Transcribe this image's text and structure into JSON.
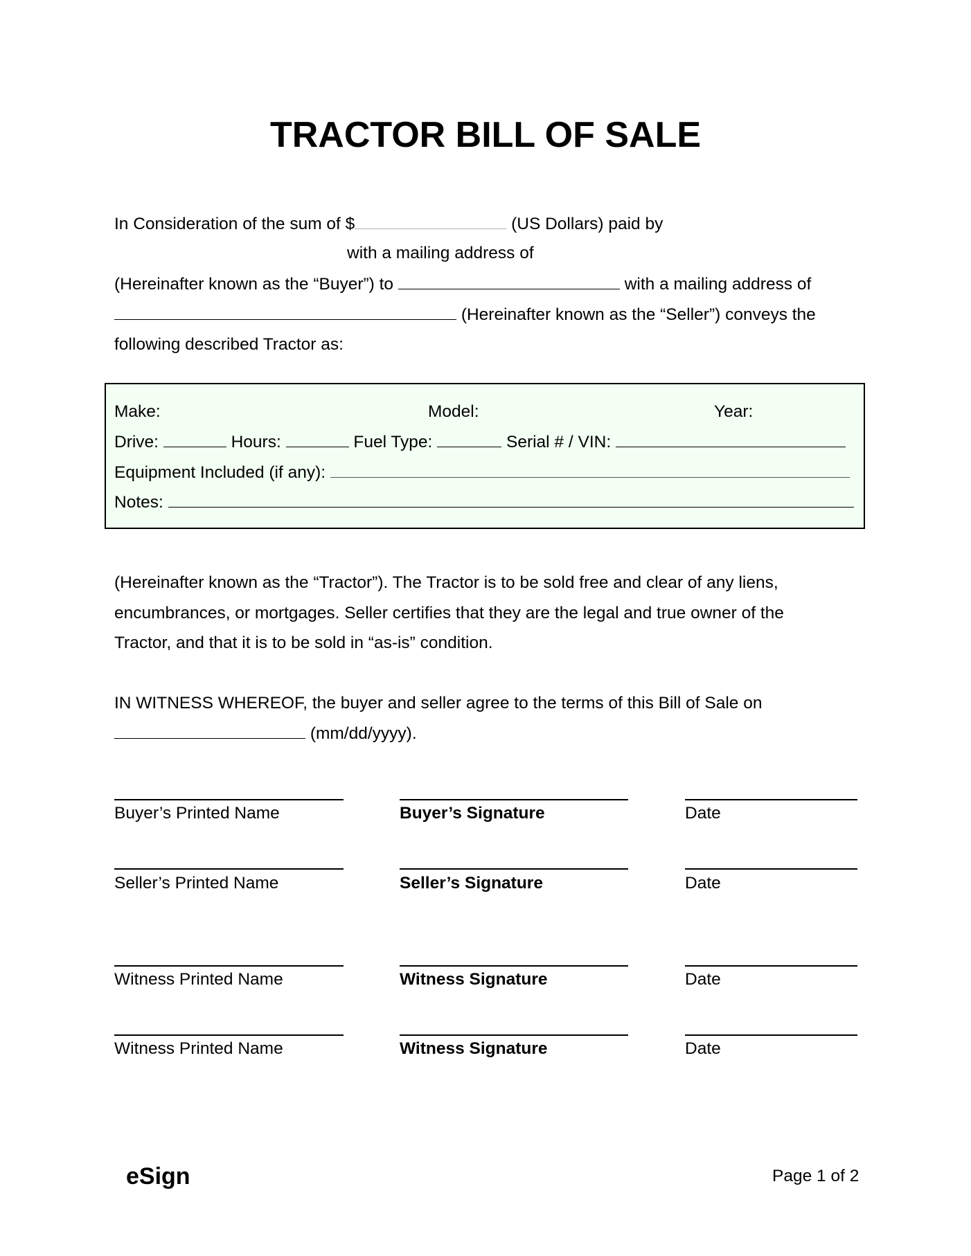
{
  "document": {
    "title": "TRACTOR BILL OF SALE",
    "intro": {
      "line1_a": "In Consideration of the sum of $",
      "line1_b": "(US Dollars) paid by",
      "line2": "with a mailing address of",
      "line3_a": "(Hereinafter known as the “Buyer”) to",
      "line3_b": "with a mailing address of",
      "line4": "(Hereinafter known as the “Seller”) conveys the",
      "line5": "following described Tractor as:"
    },
    "tractor_box": {
      "make_label": "Make:",
      "model_label": "Model:",
      "year_label": "Year:",
      "drive_label": "Drive:",
      "hours_label": "Hours:",
      "fuel_type_label": "Fuel Type:",
      "serial_label": "Serial # / VIN:",
      "equipment_label": "Equipment Included (if any):",
      "notes_label": "Notes:"
    },
    "terms": {
      "line1": "(Hereinafter known as the “Tractor”). The Tractor is to be sold free and clear of any liens,",
      "line2": "encumbrances, or mortgages. Seller certifies that they are the legal and true owner of the",
      "line3": "Tractor, and that it is to be sold in “as-is” condition."
    },
    "witness": {
      "line1": "IN WITNESS WHEREOF, the buyer and seller agree to the terms of this Bill of Sale on",
      "date_format": "(mm/dd/yyyy)."
    },
    "signatures": [
      {
        "printed": "Buyer’s Printed Name",
        "signature": "Buyer’s Signature",
        "date": "Date"
      },
      {
        "printed": "Seller’s Printed Name",
        "signature": "Seller’s Signature",
        "date": "Date"
      },
      {
        "printed": "Witness Printed Name",
        "signature": "Witness Signature",
        "date": "Date"
      },
      {
        "printed": "Witness Printed Name",
        "signature": "Witness Signature",
        "date": "Date"
      }
    ],
    "footer": {
      "brand": "eSign",
      "page": "Page 1 of 2"
    }
  },
  "colors": {
    "box_background": "#f2fff2",
    "text": "#000000"
  }
}
